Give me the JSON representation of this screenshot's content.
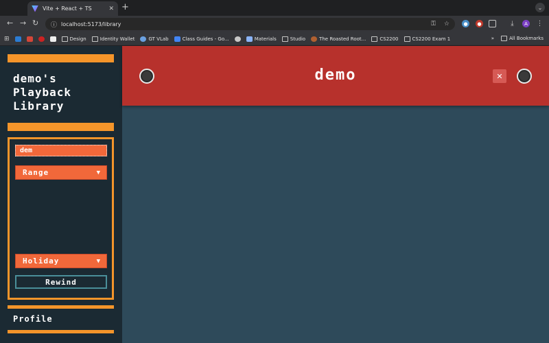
{
  "browser": {
    "tab": {
      "title": "Vite + React + TS"
    },
    "url": "localhost:5173/library",
    "profile_initial": "A",
    "bookmarks": [
      "Design",
      "Identity Wallet",
      "GT VLab",
      "Class Guides - Go...",
      "Materials",
      "Studio",
      "The Roasted Root...",
      "CS2200",
      "CS2200 Exam 1"
    ],
    "all_bookmarks": "All Bookmarks"
  },
  "sidebar": {
    "title": "demo's\nPlayback\nLibrary",
    "search": {
      "value": "dem"
    },
    "range_select": {
      "label": "Range",
      "arrow": "▼"
    },
    "holiday_select": {
      "label": "Holiday",
      "arrow": "▼"
    },
    "rewind_label": "Rewind",
    "profile_label": "Profile"
  },
  "main": {
    "header_title": "demo",
    "close_symbol": "✕"
  },
  "colors": {
    "accent_orange": "#f4952a",
    "input_orange": "#f1683a",
    "header_red": "#b7312c",
    "sidebar_bg": "#1b2a33",
    "main_bg": "#2e4a5a"
  }
}
